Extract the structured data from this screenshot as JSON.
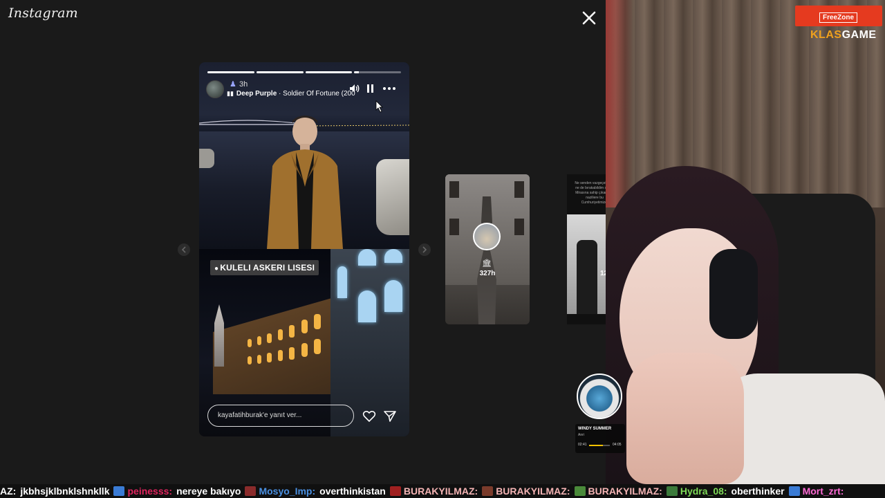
{
  "app": {
    "name": "Instagram"
  },
  "story": {
    "time": "3h",
    "music_artist": "Deep Purple",
    "music_separator": " · ",
    "music_track": "Soldier Of Fortune (200",
    "location_sticker": "KULELI ASKERI LISESI",
    "reply_placeholder": "kayafatihburak'e yanıt ver..."
  },
  "preview_left": {
    "time": "327h"
  },
  "preview_right": {
    "time": "12",
    "text": "Ne senden vazgeçebildim ne de bırakabildim seni... Mirasına sahip çıkanların naziliere bu Cumhuriyetimize."
  },
  "overlay": {
    "brand_box": "FreeZone",
    "brand_name_part1": "KLAS",
    "brand_name_part2": "GAME",
    "music_widget": {
      "title": "WINDY SUMMER",
      "artist": "Anri",
      "elapsed": "02:41",
      "total": "04:05",
      "progress": 0.66
    }
  },
  "chat": [
    {
      "user": "AZ:",
      "user_color": "#ffffff",
      "message": "jkbhsjklbnklshnkllk"
    },
    {
      "user": "peinesss:",
      "user_color": "#e0245e",
      "message": "nereye bakıyo"
    },
    {
      "user": "Mosyo_Imp:",
      "user_color": "#4a90e2",
      "message": "overthinkistan"
    },
    {
      "user": "BURAKYILMAZ:",
      "user_color": "#f4b4b4",
      "message": ""
    },
    {
      "user": "BURAKYILMAZ:",
      "user_color": "#f4b4b4",
      "message": ""
    },
    {
      "user": "BURAKYILMAZ:",
      "user_color": "#f4b4b4",
      "message": ""
    },
    {
      "user": "Hydra_08:",
      "user_color": "#7ed957",
      "message": "oberthinker"
    },
    {
      "user": "Mort_zrt:",
      "user_color": "#ff6ad5",
      "message": ""
    }
  ],
  "colors": {
    "accent": "#e53a1f",
    "brand_orange": "#f0a11e"
  }
}
